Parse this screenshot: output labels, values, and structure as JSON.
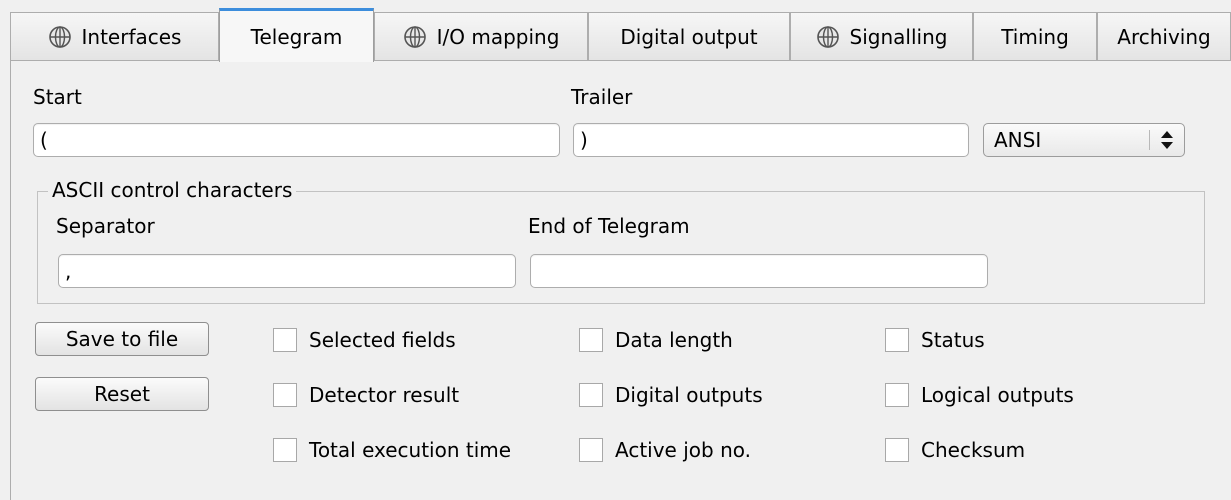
{
  "tabs": [
    {
      "label": "Interfaces",
      "icon": "globe-icon",
      "active": false
    },
    {
      "label": "Telegram",
      "icon": "",
      "active": true
    },
    {
      "label": "I/O mapping",
      "icon": "globe-icon",
      "active": false
    },
    {
      "label": "Digital output",
      "icon": "",
      "active": false
    },
    {
      "label": "Signalling",
      "icon": "globe-icon",
      "active": false
    },
    {
      "label": "Timing",
      "icon": "",
      "active": false
    },
    {
      "label": "Archiving",
      "icon": "",
      "active": false
    }
  ],
  "telegram": {
    "start_label": "Start",
    "start_value": "(",
    "trailer_label": "Trailer",
    "trailer_value": ")",
    "encoding_value": "ANSI"
  },
  "ascii_group": {
    "title": "ASCII control characters",
    "separator_label": "Separator",
    "separator_value": ",",
    "end_label": "End of Telegram",
    "end_value": ""
  },
  "buttons": {
    "save": "Save to file",
    "reset": "Reset"
  },
  "fields": [
    {
      "label": "Selected fields",
      "checked": false
    },
    {
      "label": "Data length",
      "checked": false
    },
    {
      "label": "Status",
      "checked": false
    },
    {
      "label": "Detector result",
      "checked": false
    },
    {
      "label": "Digital outputs",
      "checked": false
    },
    {
      "label": "Logical outputs",
      "checked": false
    },
    {
      "label": "Total execution time",
      "checked": false
    },
    {
      "label": "Active job no.",
      "checked": false
    },
    {
      "label": "Checksum",
      "checked": false
    }
  ],
  "colors": {
    "active_tab_accent": "#3c8ddc",
    "background": "#f0f0f0"
  }
}
